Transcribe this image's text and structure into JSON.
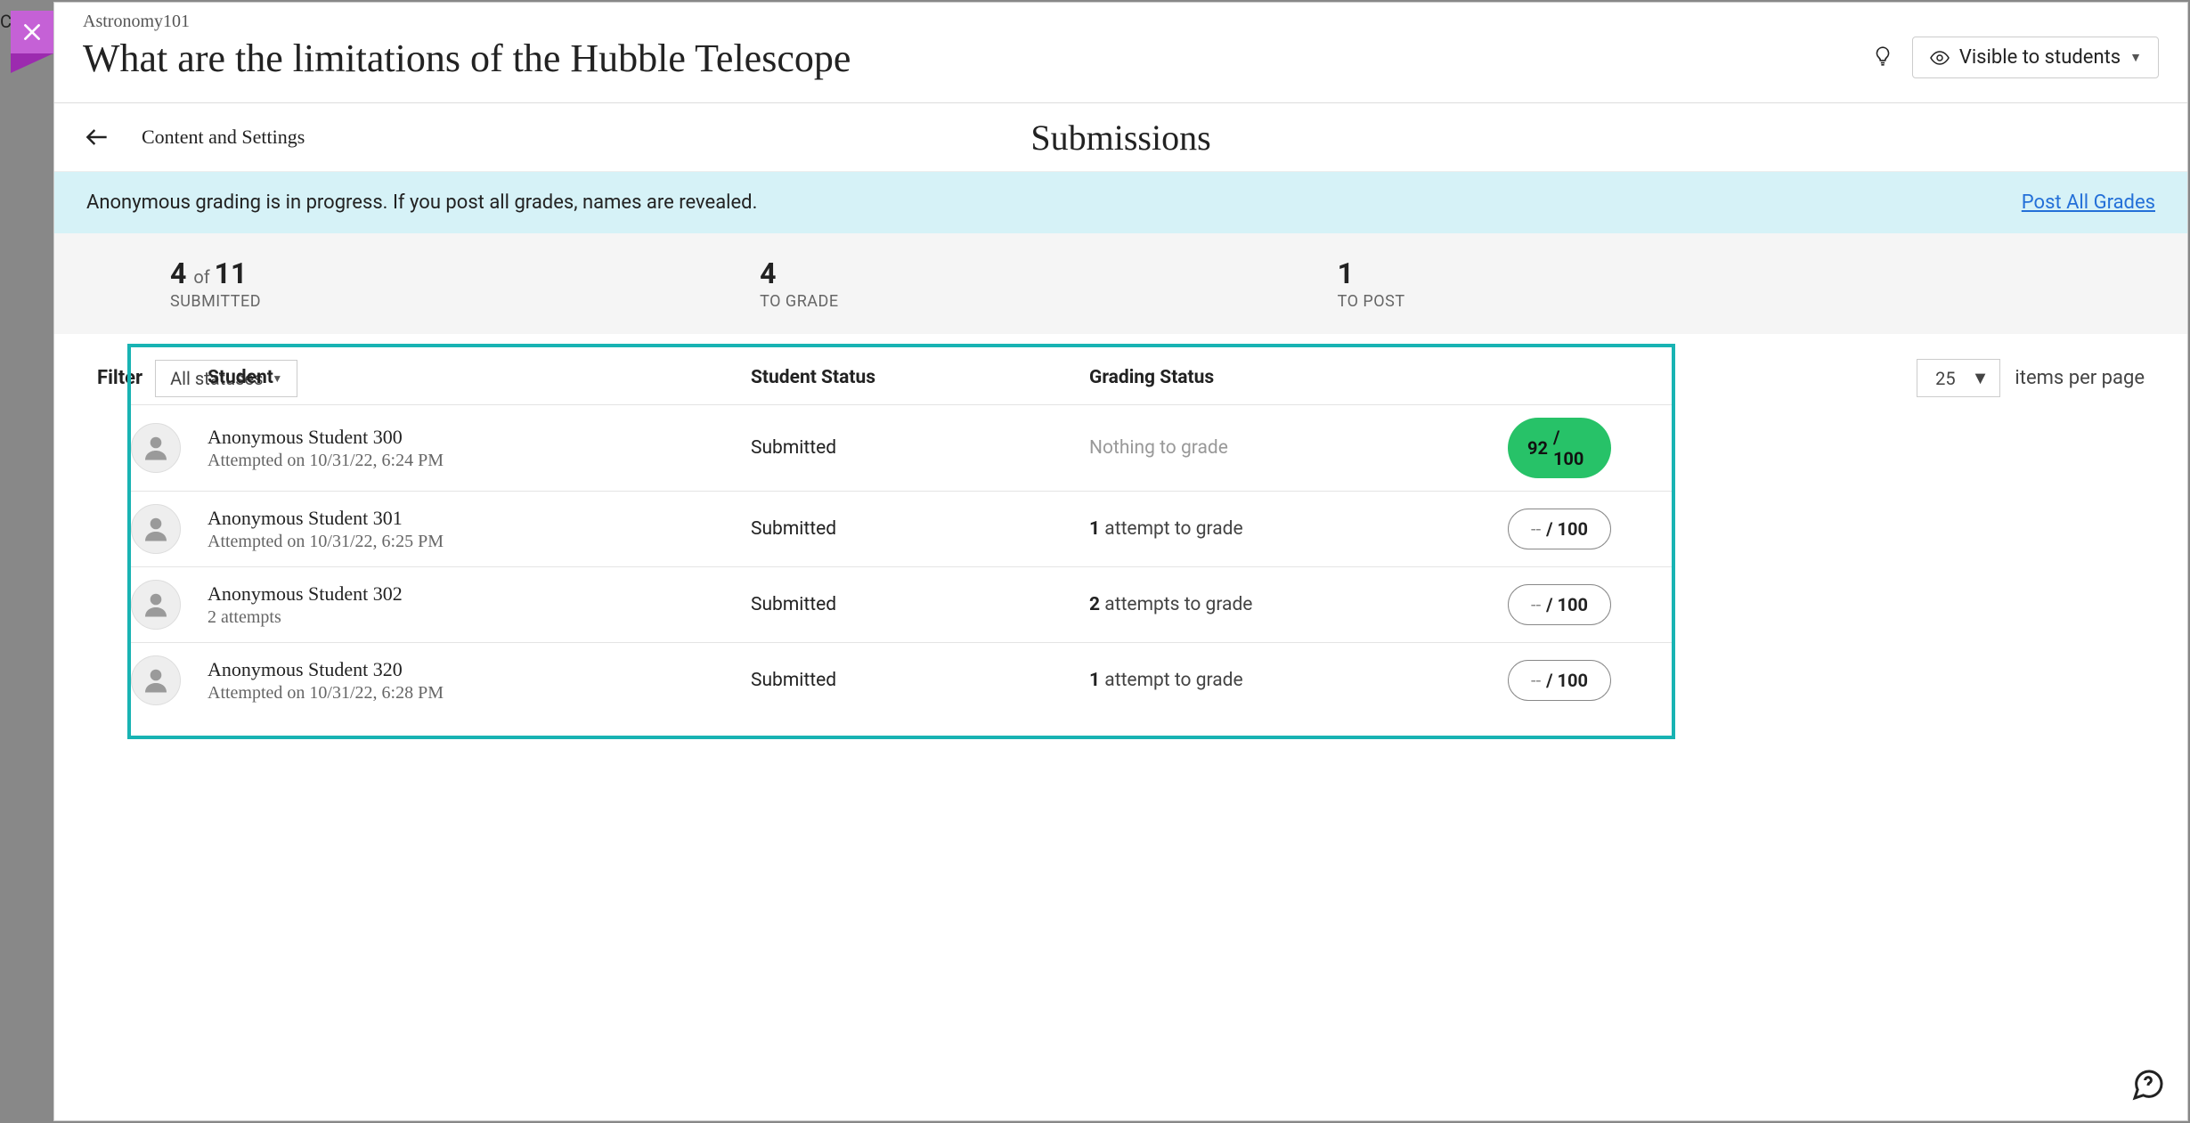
{
  "backdrop_peek": "Co",
  "header": {
    "course": "Astronomy101",
    "title": "What are the limitations of the Hubble Telescope",
    "visibility_label": "Visible to students"
  },
  "subheader": {
    "back_label": "Content and Settings",
    "title": "Submissions"
  },
  "banner": {
    "message": "Anonymous grading is in progress. If you post all grades, names are revealed.",
    "action": "Post All Grades"
  },
  "stats": {
    "submitted_count": "4",
    "submitted_of_word": "of",
    "submitted_total": "11",
    "submitted_label": "SUBMITTED",
    "to_grade_count": "4",
    "to_grade_label": "TO GRADE",
    "to_post_count": "1",
    "to_post_label": "TO POST"
  },
  "filter": {
    "label": "Filter",
    "value": "All statuses"
  },
  "pager": {
    "value": "25",
    "label": "items per page"
  },
  "columns": {
    "student": "Student",
    "status": "Student Status",
    "grading": "Grading Status"
  },
  "rows": [
    {
      "name": "Anonymous Student 300",
      "sub": "Attempted on 10/31/22, 6:24 PM",
      "status": "Submitted",
      "grading_muted": "Nothing to grade",
      "grading_bold": "",
      "grading_rest": "",
      "score": "92",
      "score_suffix": "  / 100",
      "graded": true
    },
    {
      "name": "Anonymous Student 301",
      "sub": "Attempted on 10/31/22, 6:25 PM",
      "status": "Submitted",
      "grading_muted": "",
      "grading_bold": "1",
      "grading_rest": " attempt to grade",
      "score": "--",
      "score_suffix": "  / 100",
      "graded": false
    },
    {
      "name": "Anonymous Student 302",
      "sub": "2 attempts",
      "status": "Submitted",
      "grading_muted": "",
      "grading_bold": "2",
      "grading_rest": " attempts to grade",
      "score": "--",
      "score_suffix": "  / 100",
      "graded": false
    },
    {
      "name": "Anonymous Student 320",
      "sub": "Attempted on 10/31/22, 6:28 PM",
      "status": "Submitted",
      "grading_muted": "",
      "grading_bold": "1",
      "grading_rest": " attempt to grade",
      "score": "--",
      "score_suffix": "  / 100",
      "graded": false
    }
  ]
}
